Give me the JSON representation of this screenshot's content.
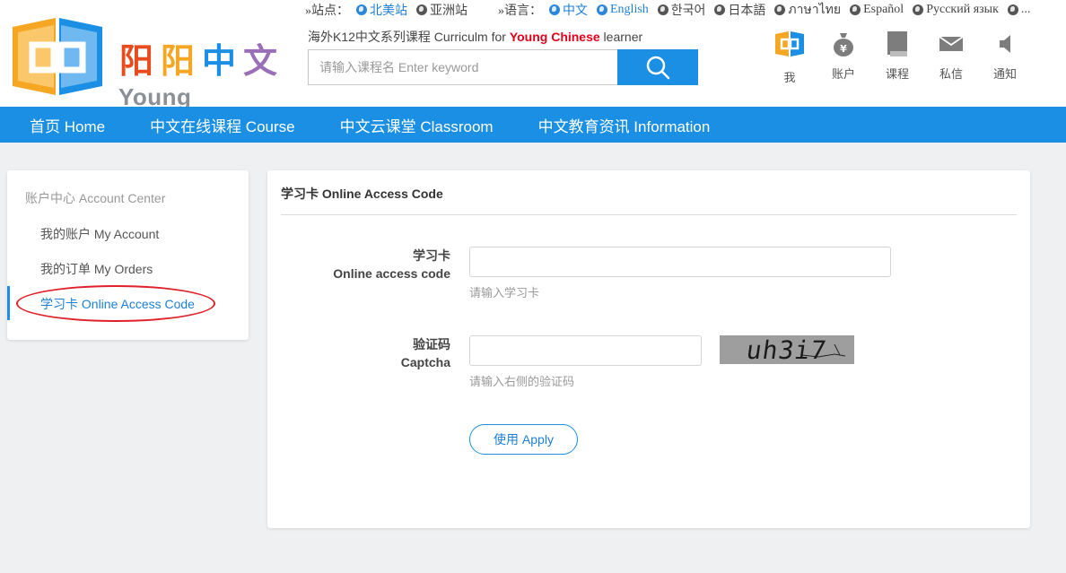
{
  "brand": {
    "logo_cn": [
      "阳",
      "阳",
      "中",
      "文"
    ],
    "logo_en": "Young Chinese",
    "logo_colors": [
      "#e84c1e",
      "#f5a623",
      "#1a8fe3",
      "#9a6fb8"
    ]
  },
  "topbar": {
    "site_label": "»站点：",
    "sites": [
      {
        "label": "北美站",
        "active": true
      },
      {
        "label": "亚洲站",
        "active": false
      }
    ],
    "lang_label": "»语言：",
    "languages": [
      {
        "label": "中文",
        "active": true
      },
      {
        "label": "English",
        "active": true
      },
      {
        "label": "한국어",
        "active": false
      },
      {
        "label": "日本語",
        "active": false
      },
      {
        "label": "ภาษาไทย",
        "active": false
      },
      {
        "label": "Español",
        "active": false
      },
      {
        "label": "Русский язык",
        "active": false
      },
      {
        "label": "...",
        "active": false
      }
    ]
  },
  "tagline": {
    "prefix": "海外K12中文系列课程 Curriculm for ",
    "highlight": "Young Chinese",
    "suffix": " learner"
  },
  "search": {
    "placeholder": "请输入课程名 Enter keyword",
    "icon": "search-icon"
  },
  "user_menu": [
    {
      "label": "我",
      "icon": "logo-icon"
    },
    {
      "label": "账户",
      "icon": "money-bag-icon"
    },
    {
      "label": "课程",
      "icon": "book-icon"
    },
    {
      "label": "私信",
      "icon": "mail-icon"
    },
    {
      "label": "通知",
      "icon": "speaker-icon"
    }
  ],
  "nav": [
    "首页 Home",
    "中文在线课程 Course",
    "中文云课堂 Classroom",
    "中文教育资讯 Information"
  ],
  "sidebar": {
    "title": "账户中心 Account Center",
    "items": [
      {
        "label": "我的账户 My Account",
        "active": false
      },
      {
        "label": "我的订单 My Orders",
        "active": false
      },
      {
        "label": "学习卡 Online Access Code",
        "active": true
      }
    ]
  },
  "form": {
    "title": "学习卡 Online Access Code",
    "code": {
      "label_cn": "学习卡",
      "label_en": "Online access code",
      "value": "",
      "hint": "请输入学习卡"
    },
    "captcha": {
      "label_cn": "验证码",
      "label_en": "Captcha",
      "value": "",
      "hint": "请输入右侧的验证码",
      "image_text": "uh3i7"
    },
    "apply_label": "使用 Apply"
  },
  "colors": {
    "accent": "#1a8fe3",
    "brand_red": "#e3001b",
    "annotation_red": "#e0202a",
    "page_bg": "#eef0f2"
  }
}
